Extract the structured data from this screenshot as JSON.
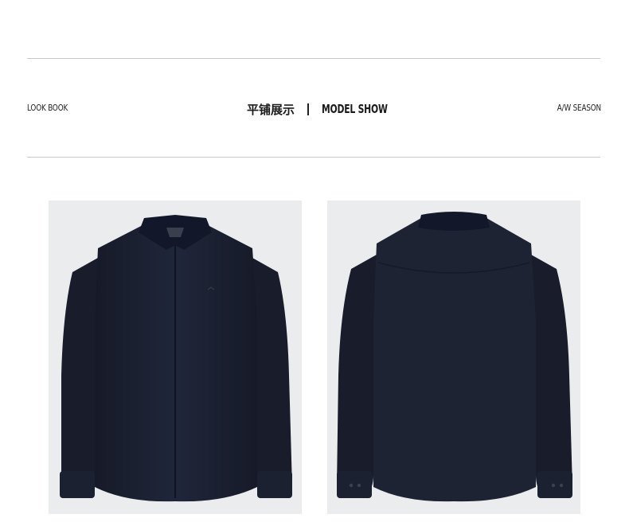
{
  "header": {
    "left_label": "LOOK BOOK",
    "title_cn": "平铺展示",
    "title_en": "MODEL SHOW",
    "right_label": "A/W SEASON"
  },
  "gallery": {
    "items": [
      {
        "view": "front",
        "icon": "shirt-front-image"
      },
      {
        "view": "back",
        "icon": "shirt-back-image"
      }
    ]
  },
  "colors": {
    "shirt": "#1d2233",
    "photo_background": "#ebecee",
    "divider": "#c9c9c9"
  }
}
